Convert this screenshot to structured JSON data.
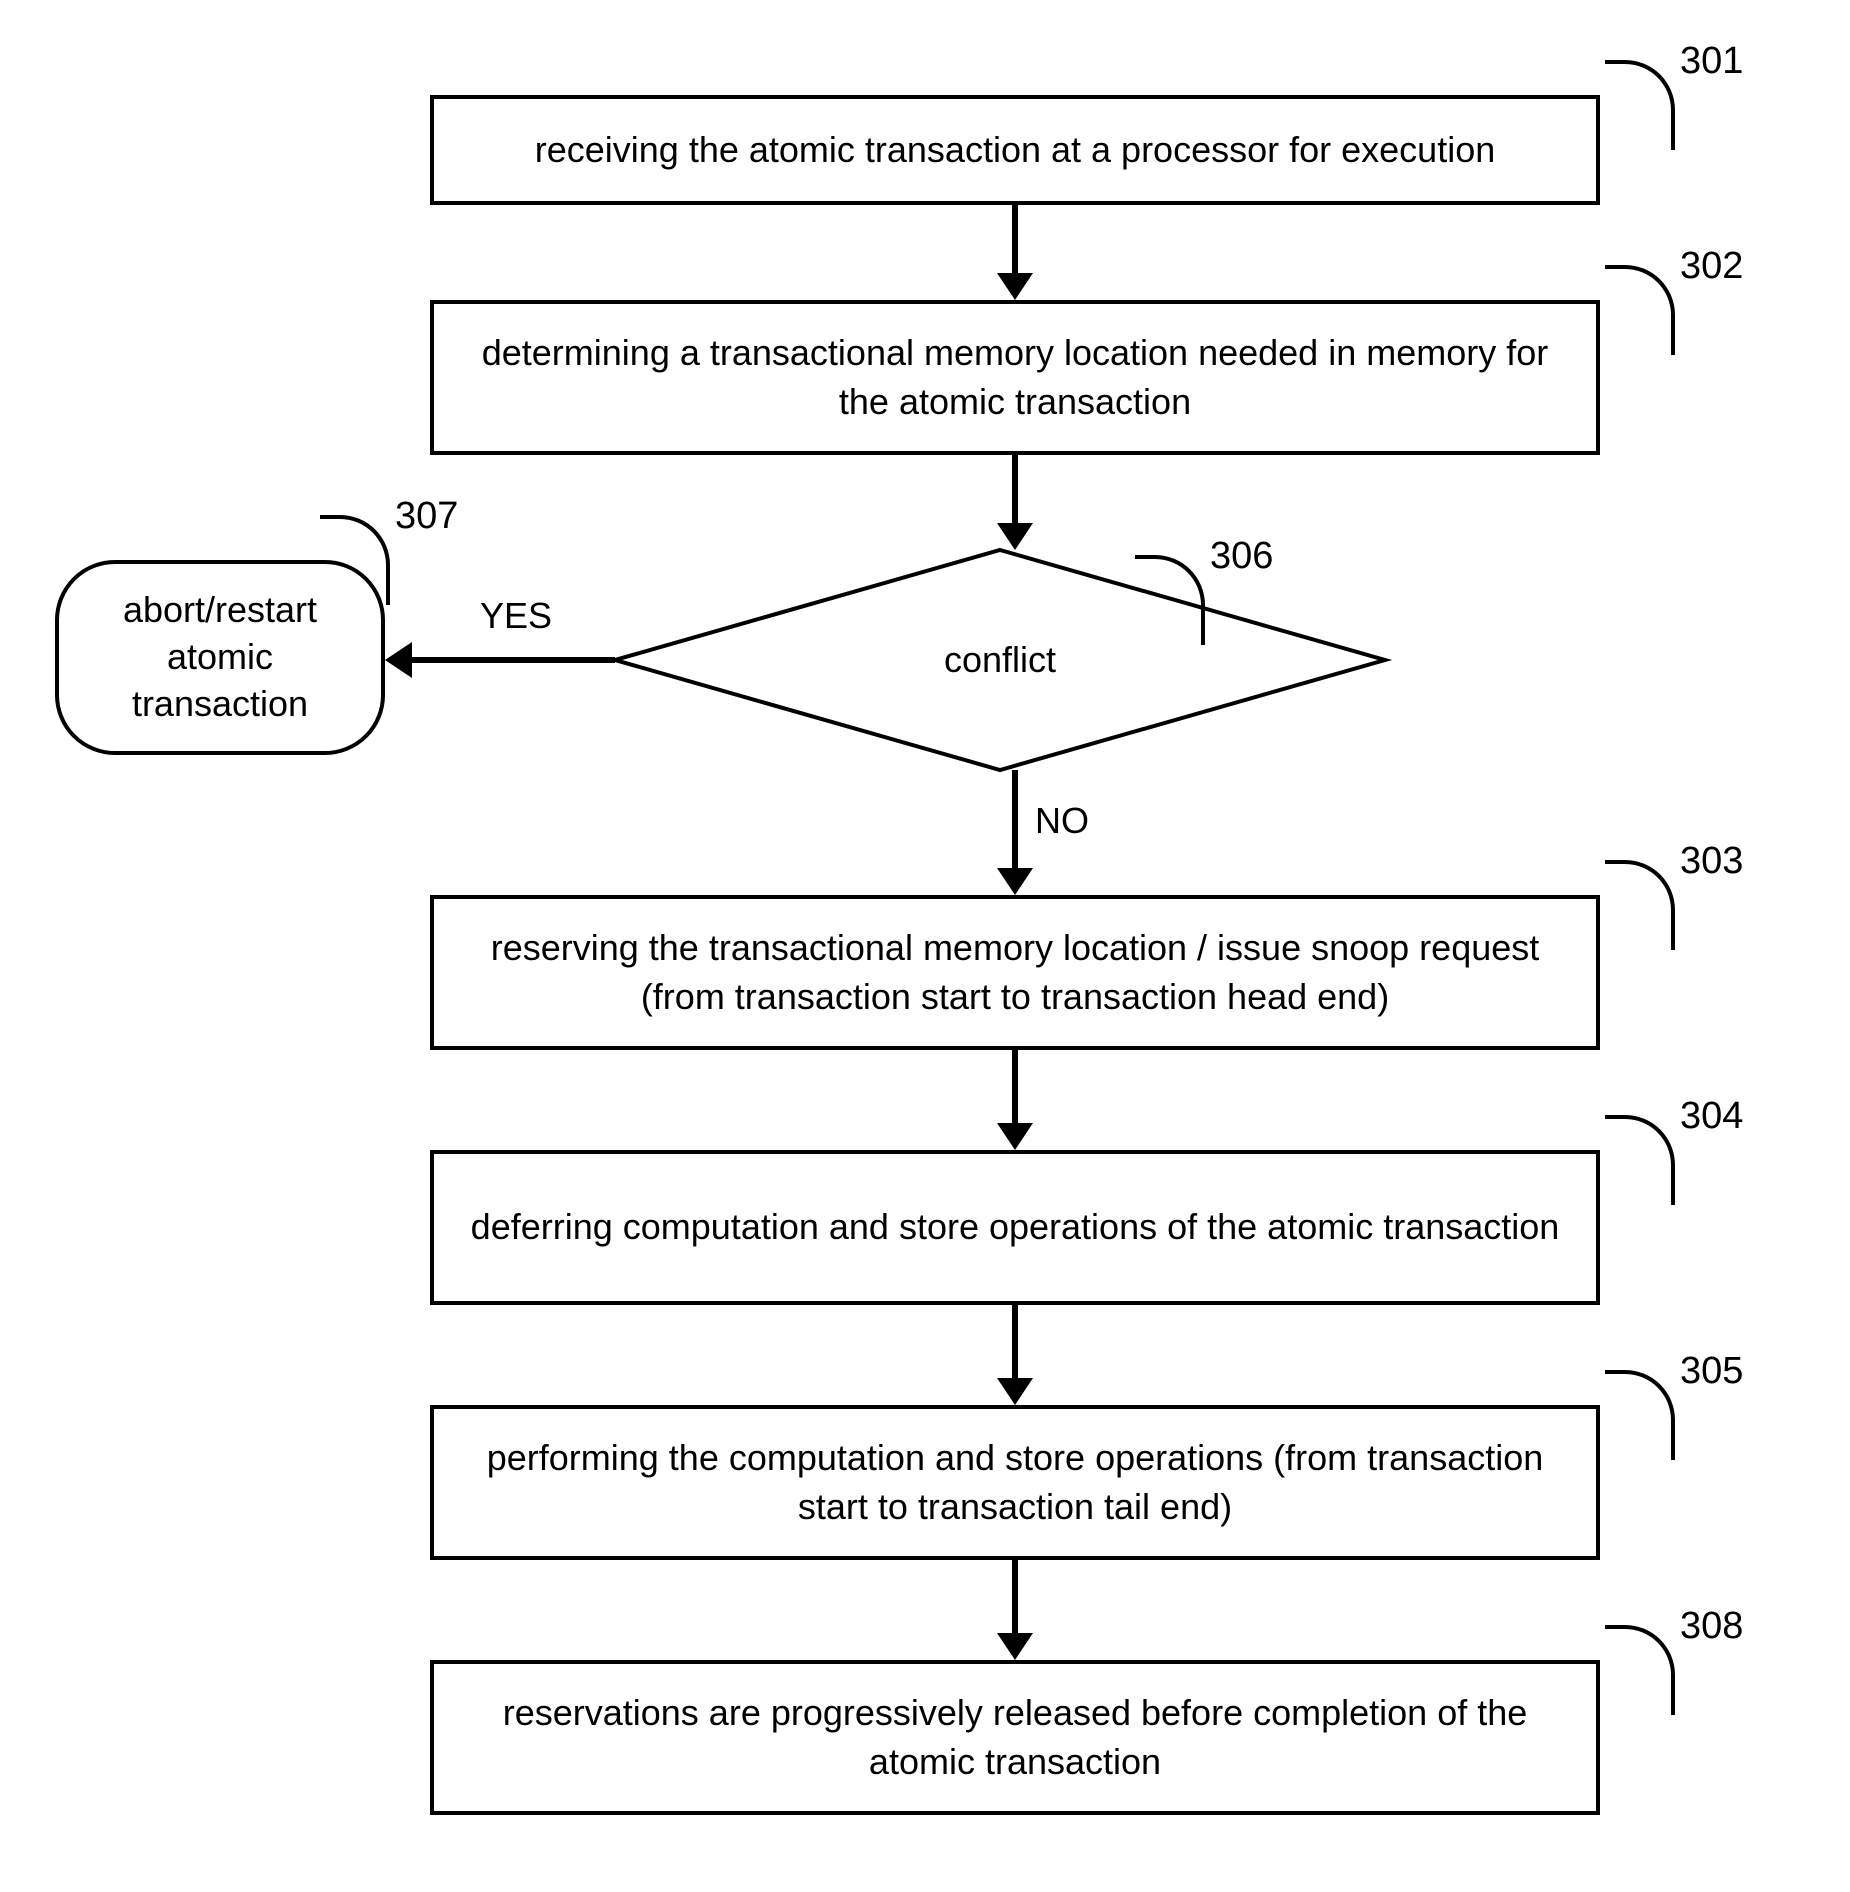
{
  "nodes": {
    "n301": {
      "label": "301",
      "text": "receiving the atomic transaction at a processor for execution"
    },
    "n302": {
      "label": "302",
      "text": "determining a transactional memory location needed in memory for the atomic transaction"
    },
    "n303": {
      "label": "303",
      "text": "reserving the transactional memory location / issue snoop request (from transaction start to transaction head end)"
    },
    "n304": {
      "label": "304",
      "text": "deferring computation and store operations of the atomic transaction"
    },
    "n305": {
      "label": "305",
      "text": "performing the computation and store operations (from transaction start to transaction tail end)"
    },
    "n306": {
      "label": "306",
      "text": "conflict"
    },
    "n307": {
      "label": "307",
      "text": "abort/restart atomic transaction"
    },
    "n308": {
      "label": "308",
      "text": "reservations are progressively released before completion of the atomic transaction"
    }
  },
  "edges": {
    "yes": "YES",
    "no": "NO"
  },
  "chart_data": {
    "type": "flowchart",
    "nodes": [
      {
        "id": "301",
        "shape": "process",
        "text": "receiving the atomic transaction at a processor for execution"
      },
      {
        "id": "302",
        "shape": "process",
        "text": "determining a transactional memory location needed in memory for the atomic transaction"
      },
      {
        "id": "306",
        "shape": "decision",
        "text": "conflict"
      },
      {
        "id": "307",
        "shape": "terminator",
        "text": "abort/restart atomic transaction"
      },
      {
        "id": "303",
        "shape": "process",
        "text": "reserving the transactional memory location / issue snoop request (from transaction start to transaction head end)"
      },
      {
        "id": "304",
        "shape": "process",
        "text": "deferring computation and store operations of the atomic transaction"
      },
      {
        "id": "305",
        "shape": "process",
        "text": "performing the computation and store operations (from transaction start to transaction tail end)"
      },
      {
        "id": "308",
        "shape": "process",
        "text": "reservations are progressively released before completion of the atomic transaction"
      }
    ],
    "edges": [
      {
        "from": "301",
        "to": "302",
        "label": ""
      },
      {
        "from": "302",
        "to": "306",
        "label": ""
      },
      {
        "from": "306",
        "to": "307",
        "label": "YES"
      },
      {
        "from": "306",
        "to": "303",
        "label": "NO"
      },
      {
        "from": "303",
        "to": "304",
        "label": ""
      },
      {
        "from": "304",
        "to": "305",
        "label": ""
      },
      {
        "from": "305",
        "to": "308",
        "label": ""
      }
    ]
  }
}
